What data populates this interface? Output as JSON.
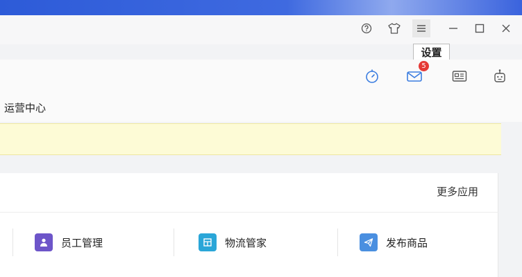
{
  "window_controls": {
    "help": "help-icon",
    "skin": "shirt-icon",
    "settings": "menu-icon",
    "minimize": "minimize-icon",
    "maximize": "maximize-icon",
    "close": "close-icon"
  },
  "tooltip": {
    "text": "设置"
  },
  "toolbar": {
    "mail_badge": "5",
    "icons": [
      "timer-icon",
      "mail-icon",
      "id-card-icon",
      "robot-icon"
    ]
  },
  "breadcrumb": {
    "text": "运营中心"
  },
  "apps_panel": {
    "more_label": "更多应用",
    "apps": [
      {
        "label": "员工管理",
        "icon": "employee-icon",
        "color": "#6d55c9"
      },
      {
        "label": "物流管家",
        "icon": "logistics-icon",
        "color": "#2aa6d8"
      },
      {
        "label": "发布商品",
        "icon": "publish-icon",
        "color": "#4a8fe0"
      }
    ]
  }
}
